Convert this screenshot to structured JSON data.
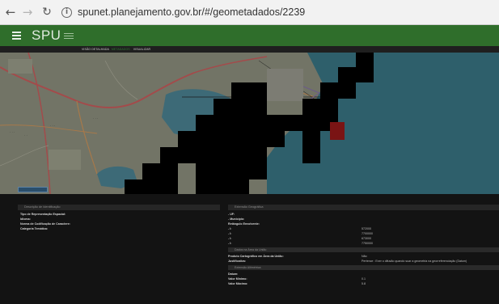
{
  "browser": {
    "url": "spunet.planejamento.gov.br/#/geometadados/2239",
    "back_icon": "back-arrow-icon",
    "forward_icon": "forward-arrow-icon",
    "reload_icon": "reload-icon",
    "info_icon": "info-icon"
  },
  "app": {
    "logo": "SPU",
    "brand_color": "#2f6e2b"
  },
  "submenu": {
    "items": [
      "VISÃO DETALHADA",
      "METADADOS",
      "VISUALIZAR"
    ]
  },
  "left_panel": {
    "title": "Descrição de Identificação",
    "rows": [
      {
        "label": "Tipo de Representação Espacial:",
        "value": ""
      },
      {
        "label": "Idioma:",
        "value": ""
      },
      {
        "label": "Norma de Codificação de Caractere:",
        "value": ""
      },
      {
        "label": "Categoria Temática:",
        "value": ""
      }
    ]
  },
  "right_panel": {
    "title": "Extensão Geográfica",
    "rows": [
      {
        "label": "- UF:",
        "value": ""
      },
      {
        "label": "- Município:",
        "value": ""
      },
      {
        "label": "Retângulo Envolvente:",
        "value": ""
      },
      {
        "label": "- l:",
        "value": "572000"
      },
      {
        "label": "- l:",
        "value": "7700000"
      },
      {
        "label": "- l:",
        "value": "673000"
      },
      {
        "label": "- l:",
        "value": "7750000"
      }
    ],
    "section2_title": "Dados na Área da União",
    "section2_rows": [
      {
        "label": "Produto Cartográfico em Área da União:",
        "value": "Não"
      },
      {
        "label": "Justificativa:",
        "value": "Pertence : Exer o difusão quando suar a geometria na georreferenciação (Datum)"
      }
    ],
    "section3_title": "Extensão Altimétrica",
    "section3_rows": [
      {
        "label": "Datum:",
        "value": ""
      },
      {
        "label": "Valor Mínimo:",
        "value": "0.1"
      },
      {
        "label": "Valor Máximo:",
        "value": "5.8"
      }
    ]
  }
}
